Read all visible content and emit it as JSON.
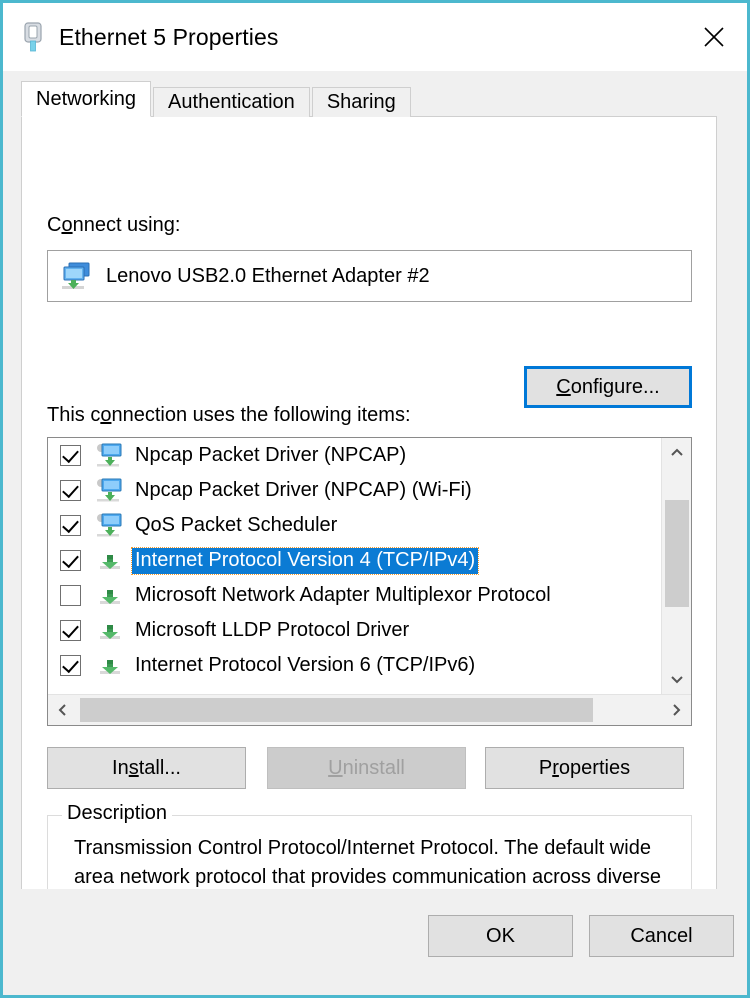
{
  "window": {
    "title": "Ethernet 5 Properties",
    "icon": "ethernet-connector-icon",
    "close_label": "✕",
    "border_color": "#4cb8ce"
  },
  "tabs": [
    {
      "label": "Networking",
      "active": true
    },
    {
      "label": "Authentication",
      "active": false
    },
    {
      "label": "Sharing",
      "active": false
    }
  ],
  "networking": {
    "connect_using_label_pre": "C",
    "connect_using_label_accel": "o",
    "connect_using_label_post": "nnect using:",
    "adapter": {
      "name": "Lenovo USB2.0 Ethernet Adapter #2",
      "icon": "network-adapter-icon"
    },
    "configure_button": {
      "pre": "",
      "accel": "C",
      "post": "onfigure...",
      "focused": true,
      "focus_color": "#0078d7"
    },
    "items_label_pre": "This c",
    "items_label_accel": "o",
    "items_label_post": "nnection uses the following items:",
    "items": [
      {
        "label": "Npcap Packet Driver (NPCAP)",
        "checked": true,
        "selected": false,
        "icon": "network-service-icon"
      },
      {
        "label": "Npcap Packet Driver (NPCAP) (Wi-Fi)",
        "checked": true,
        "selected": false,
        "icon": "network-service-icon"
      },
      {
        "label": "QoS Packet Scheduler",
        "checked": true,
        "selected": false,
        "icon": "network-service-icon"
      },
      {
        "label": "Internet Protocol Version 4 (TCP/IPv4)",
        "checked": true,
        "selected": true,
        "icon": "network-protocol-icon"
      },
      {
        "label": "Microsoft Network Adapter Multiplexor Protocol",
        "checked": false,
        "selected": false,
        "icon": "network-protocol-icon"
      },
      {
        "label": "Microsoft LLDP Protocol Driver",
        "checked": true,
        "selected": false,
        "icon": "network-protocol-icon"
      },
      {
        "label": "Internet Protocol Version 6 (TCP/IPv6)",
        "checked": true,
        "selected": false,
        "icon": "network-protocol-icon"
      }
    ],
    "selection_color": "#0b7bd4",
    "focus_outline_color": "#f59b2c",
    "install_button": {
      "pre": "In",
      "accel": "s",
      "post": "tall...",
      "disabled": false
    },
    "uninstall_button": {
      "pre": "",
      "accel": "U",
      "post": "ninstall",
      "disabled": true
    },
    "properties_button": {
      "pre": "P",
      "accel": "r",
      "post": "operties",
      "disabled": false
    },
    "description": {
      "title": "Description",
      "text": "Transmission Control Protocol/Internet Protocol. The default wide area network protocol that provides communication across diverse interconnected networks."
    }
  },
  "footer": {
    "ok_label": "OK",
    "cancel_label": "Cancel"
  }
}
